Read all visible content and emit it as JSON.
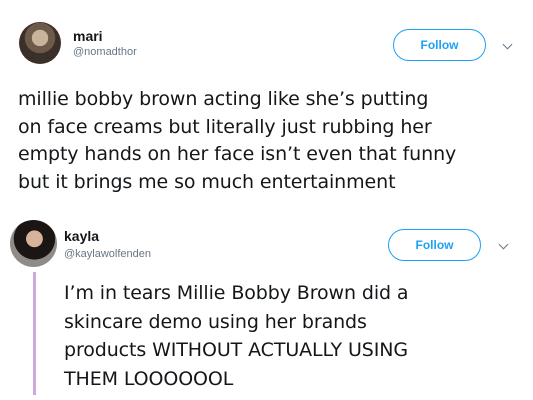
{
  "tweets": [
    {
      "name": "mari",
      "handle": "@nomadthor",
      "follow_label": "Follow",
      "lines": [
        "millie bobby brown acting like she’s putting",
        "on face creams but literally just rubbing her",
        "empty hands on her face isn’t even that funny",
        "but it brings me so much entertainment"
      ]
    },
    {
      "name": "kayla",
      "handle": "@kaylawolfenden",
      "follow_label": "Follow",
      "lines": [
        "I’m in tears Millie Bobby Brown did a",
        "skincare demo using her brands",
        "products WITHOUT ACTUALLY USING",
        "THEM LOOOOOOL"
      ]
    }
  ],
  "colors": {
    "accent": "#1da1f2",
    "handle": "#657786",
    "text": "#14171a",
    "quote_bar": "#cfa8e0"
  },
  "icons": [
    "avatar",
    "chevron-down-icon"
  ]
}
